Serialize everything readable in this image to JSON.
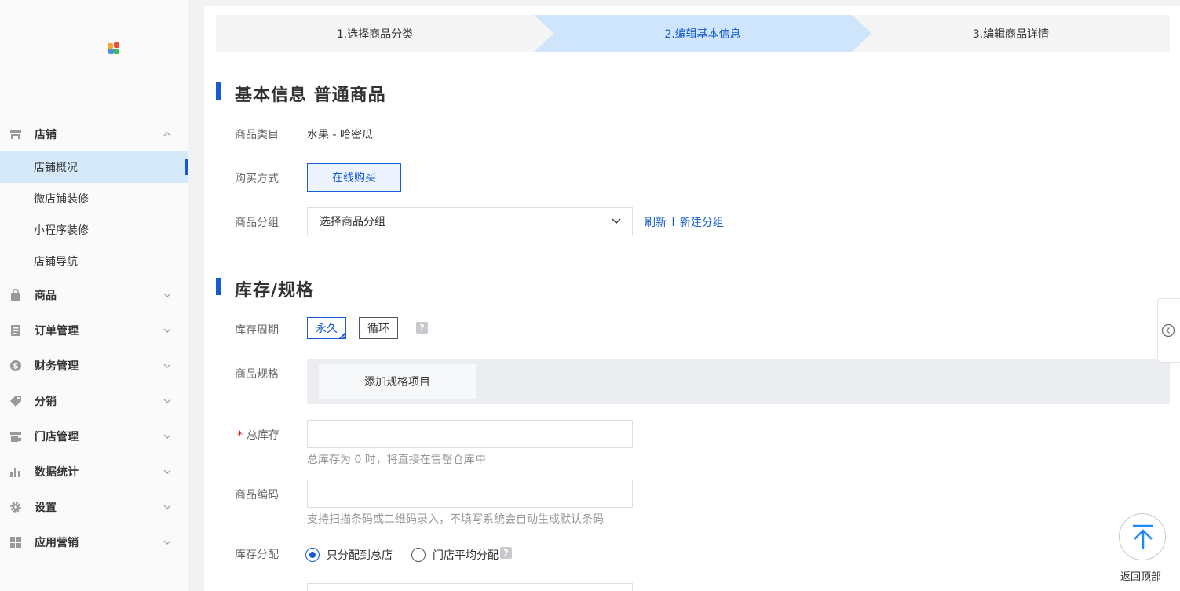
{
  "sidebar": {
    "groups": [
      {
        "label": "店铺",
        "icon": "store-icon",
        "expanded": true
      },
      {
        "label": "商品",
        "icon": "bag-icon"
      },
      {
        "label": "订单管理",
        "icon": "order-icon"
      },
      {
        "label": "财务管理",
        "icon": "finance-icon"
      },
      {
        "label": "分销",
        "icon": "tag-icon"
      },
      {
        "label": "门店管理",
        "icon": "shop-icon"
      },
      {
        "label": "数据统计",
        "icon": "chart-icon"
      },
      {
        "label": "设置",
        "icon": "gear-icon"
      },
      {
        "label": "应用营销",
        "icon": "apps-icon"
      }
    ],
    "store_items": [
      {
        "label": "店铺概况",
        "active": true
      },
      {
        "label": "微店铺装修"
      },
      {
        "label": "小程序装修"
      },
      {
        "label": "店铺导航"
      }
    ]
  },
  "steps": [
    {
      "label": "1.选择商品分类"
    },
    {
      "label": "2.编辑基本信息",
      "active": true
    },
    {
      "label": "3.编辑商品详情"
    }
  ],
  "basic": {
    "title": "基本信息 普通商品",
    "category_label": "商品类目",
    "category_value": "水果 - 哈密瓜",
    "purchase_label": "购买方式",
    "purchase_value": "在线购买",
    "group_label": "商品分组",
    "group_placeholder": "选择商品分组",
    "refresh_link": "刷新",
    "link_separator": "l",
    "new_group_link": "新建分组"
  },
  "stock": {
    "title": "库存/规格",
    "period_label": "库存周期",
    "period_options": [
      "永久",
      "循环"
    ],
    "period_selected": "永久",
    "spec_label": "商品规格",
    "add_spec_button": "添加规格项目",
    "total_label": "总库存",
    "total_required_mark": "*",
    "total_hint": "总库存为 0 时，将直接在售罄仓库中",
    "code_label": "商品编码",
    "code_hint": "支持扫描条码或二维码录入，不填写系统会自动生成默认条码",
    "alloc_label": "库存分配",
    "alloc_options": [
      "只分配到总店",
      "门店平均分配"
    ],
    "alloc_selected": "只分配到总店"
  },
  "help_glyph": "?",
  "back_to_top_label": "返回顶部",
  "colors": {
    "accent": "#155bd4",
    "active_step_bg": "#cfe5fb",
    "sidebar_active_bg": "#d6e9fb",
    "required": "#d40000"
  }
}
